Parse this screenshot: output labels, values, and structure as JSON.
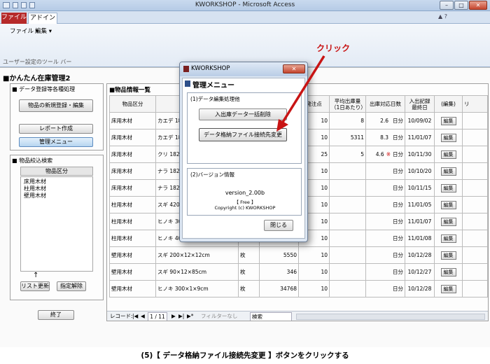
{
  "window": {
    "title": "KWORKSHOP - Microsoft Access"
  },
  "ribbon": {
    "tab_file": "ファイル",
    "tab_addin": "アドイン",
    "menu_file": "ファイル ▾",
    "menu_edit": "編集 ▾",
    "toolbar_label": "ユーザー設定のツール バー"
  },
  "form": {
    "title": "■かんたん在庫管理2",
    "group_data": "■ データ登録等各種処理",
    "btn_new_product": "物品の新規登録・編集",
    "btn_report": "レポート作成",
    "btn_menu": "管理メニュー",
    "group_filter": "■ 物品絞込検索",
    "category_header": "物品区分",
    "categories": [
      "床用木材",
      "柱用木材",
      "壁用木材"
    ],
    "arrow": "↑",
    "btn_refresh": "リスト更新",
    "btn_clear": "指定解除",
    "btn_exit": "終了"
  },
  "list": {
    "title": "■物品情報一覧",
    "headers": {
      "category": "物品区分",
      "order_point": "発注点",
      "avg_out": "平均出庫量\n（1日あたり）",
      "days": "出庫対応日数",
      "last_date": "入出記録\n最終日",
      "edit": "(編集)",
      "more": "リ"
    },
    "rows": [
      {
        "category": "床用木材",
        "name": "カエデ 182",
        "unit": "",
        "stock": "",
        "order_point": "10",
        "avg": "8",
        "days": "2.6",
        "days_unit": "日分",
        "mark": "",
        "date": "10/09/02",
        "edit": "編集"
      },
      {
        "category": "床用木材",
        "name": "カエデ 18",
        "unit": "",
        "stock": "",
        "order_point": "10",
        "avg": "5311",
        "days": "8.3",
        "days_unit": "日分",
        "mark": "",
        "date": "11/01/07",
        "edit": "編集"
      },
      {
        "category": "床用木材",
        "name": "クリ 182",
        "unit": "",
        "stock": "",
        "order_point": "25",
        "avg": "5",
        "days": "4.6",
        "days_unit": "日分",
        "mark": "※",
        "date": "10/11/30",
        "edit": "編集"
      },
      {
        "category": "床用木材",
        "name": "ナラ 182",
        "unit": "",
        "stock": "",
        "order_point": "10",
        "avg": "",
        "days": "",
        "days_unit": "日分",
        "mark": "",
        "date": "10/10/20",
        "edit": "編集"
      },
      {
        "category": "床用木材",
        "name": "ナラ 182",
        "unit": "",
        "stock": "",
        "order_point": "10",
        "avg": "",
        "days": "",
        "days_unit": "日分",
        "mark": "",
        "date": "10/11/15",
        "edit": "編集"
      },
      {
        "category": "柱用木材",
        "name": "スギ 420",
        "unit": "",
        "stock": "",
        "order_point": "10",
        "avg": "",
        "days": "",
        "days_unit": "日分",
        "mark": "",
        "date": "11/01/05",
        "edit": "編集"
      },
      {
        "category": "柱用木材",
        "name": "ヒノキ 30",
        "unit": "",
        "stock": "",
        "order_point": "10",
        "avg": "",
        "days": "",
        "days_unit": "日分",
        "mark": "",
        "date": "11/01/07",
        "edit": "編集"
      },
      {
        "category": "柱用木材",
        "name": "ヒノキ 40",
        "unit": "",
        "stock": "",
        "order_point": "10",
        "avg": "",
        "days": "",
        "days_unit": "日分",
        "mark": "",
        "date": "11/01/08",
        "edit": "編集"
      },
      {
        "category": "壁用木材",
        "name": "スギ 200×12×12cm",
        "unit": "枚",
        "stock": "5550",
        "order_point": "10",
        "avg": "",
        "days": "",
        "days_unit": "日分",
        "mark": "",
        "date": "10/12/28",
        "edit": "編集"
      },
      {
        "category": "壁用木材",
        "name": "スギ 90×12×85cm",
        "unit": "枚",
        "stock": "346",
        "order_point": "10",
        "avg": "",
        "days": "",
        "days_unit": "日分",
        "mark": "",
        "date": "10/12/27",
        "edit": "編集"
      },
      {
        "category": "壁用木材",
        "name": "ヒノキ 300×1×9cm",
        "unit": "枚",
        "stock": "34768",
        "order_point": "10",
        "avg": "",
        "days": "",
        "days_unit": "日分",
        "mark": "",
        "date": "10/12/28",
        "edit": "編集"
      }
    ],
    "nav": {
      "label": "レコード:",
      "first": "|◀",
      "prev": "◀",
      "position": "1 / 11",
      "next": "▶",
      "last": "▶|",
      "new": "▶*",
      "filter": "フィルターなし",
      "search": "検索"
    }
  },
  "dialog": {
    "window_title": "KWORKSHOP",
    "header": "管理メニュー",
    "section1": "(1)データ編集処理他",
    "btn_delete": "入出庫データ一括削除",
    "btn_link": "データ格納ファイル接続先変更",
    "section2": "(2)バージョン情報",
    "version": "version_2.00b",
    "free": "【 Free 】",
    "copyright": "Copyright (c) KWORKSHOP",
    "btn_close": "閉じる"
  },
  "annotation": {
    "click_label": "クリック",
    "color": "#d01010"
  },
  "footer": {
    "caption": "(5)【 データ格納ファイル接続先変更 】ボタンをクリックする"
  }
}
